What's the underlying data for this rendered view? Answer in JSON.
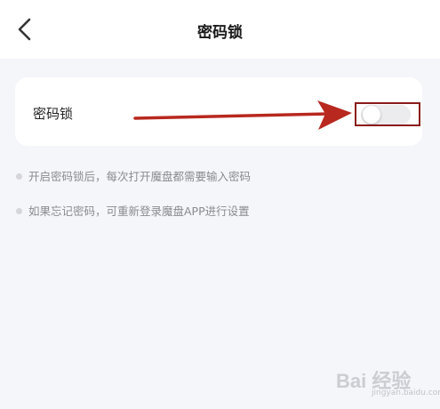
{
  "header": {
    "title": "密码锁",
    "back_icon": "chevron-left-icon"
  },
  "password_lock": {
    "label": "密码锁",
    "toggle_on": false
  },
  "notes": [
    "开启密码锁后，每次打开魔盘都需要输入密码",
    "如果忘记密码，可重新登录魔盘APP进行设置"
  ],
  "annotation": {
    "color": "#b22222"
  },
  "watermark": {
    "text": "Bai 经验",
    "sub": "jingyan.baidu.com"
  }
}
